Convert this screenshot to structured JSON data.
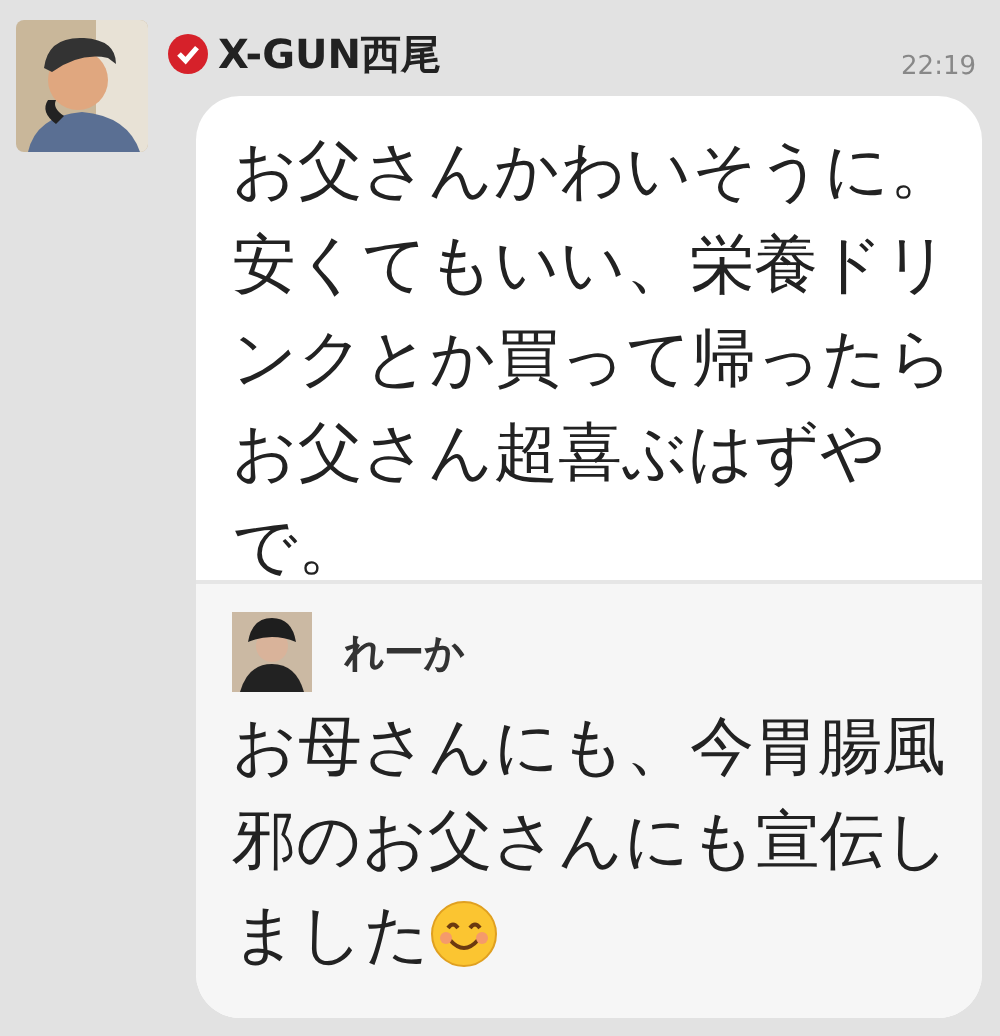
{
  "message": {
    "sender": "X-GUN西尾",
    "verified": true,
    "time": "22:19",
    "text": "お父さんかわいそうに。安くてもいい、栄養ドリンクとか買って帰ったらお父さん超喜ぶはずやで。",
    "reply": {
      "sender": "れーか",
      "text": "お母さんにも、今胃腸風邪のお父さんにも宣伝しました"
    }
  }
}
